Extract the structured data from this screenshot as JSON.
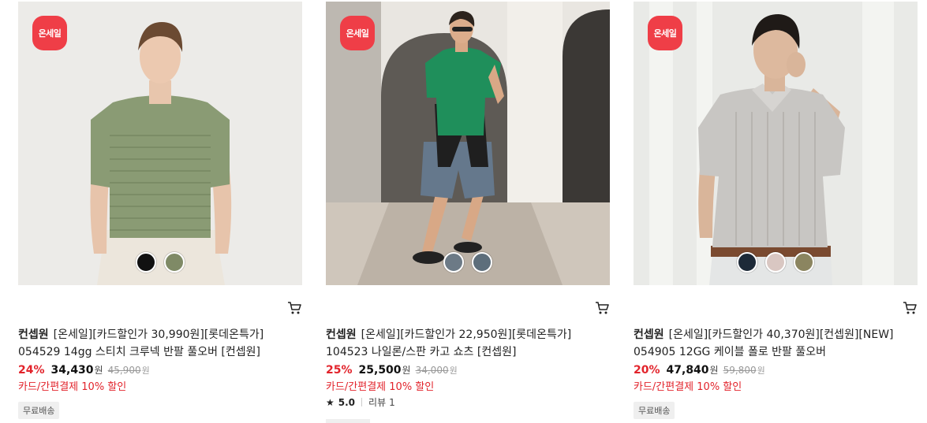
{
  "products": [
    {
      "sale_badge": "온세일",
      "brand": "컨셉원",
      "name": "[온세일][카드할인가 30,990원][롯데온특가] 054529 14gg 스티치 크루넥 반팔 풀오버 [컨셉원]",
      "discount": "24%",
      "price": "34,430",
      "price_unit": "원",
      "original_price": "45,900",
      "original_unit": "원",
      "card_discount": "카드/간편결제 10% 할인",
      "shipping": "무료배송",
      "swatches": [
        "#111111",
        "#7f8a66"
      ],
      "icon": "cart-icon"
    },
    {
      "sale_badge": "온세일",
      "brand": "컨셉원",
      "name": "[온세일][카드할인가 22,950원][롯데온특가] 104523 나일론/스판 카고 쇼츠 [컨셉원]",
      "discount": "25%",
      "price": "25,500",
      "price_unit": "원",
      "original_price": "34,000",
      "original_unit": "원",
      "card_discount": "카드/간편결제 10% 할인",
      "rating": "5.0",
      "review_label": "리뷰",
      "review_count": "1",
      "swatches": [
        "#6c7a86",
        "#5d6e7b"
      ],
      "icon": "cart-icon"
    },
    {
      "sale_badge": "온세일",
      "brand": "컨셉원",
      "name": "[온세일][카드할인가 40,370원][컨셉원][NEW] 054905 12GG 케이블 폴로 반팔 풀오버",
      "discount": "20%",
      "price": "47,840",
      "price_unit": "원",
      "original_price": "59,800",
      "original_unit": "원",
      "card_discount": "카드/간편결제 10% 할인",
      "shipping": "무료배송",
      "swatches": [
        "#1d2a38",
        "#d9c7c2",
        "#8b8560"
      ],
      "icon": "cart-icon"
    }
  ],
  "colors": {
    "badge": "#ef3e47",
    "discount": "#e2232b"
  }
}
